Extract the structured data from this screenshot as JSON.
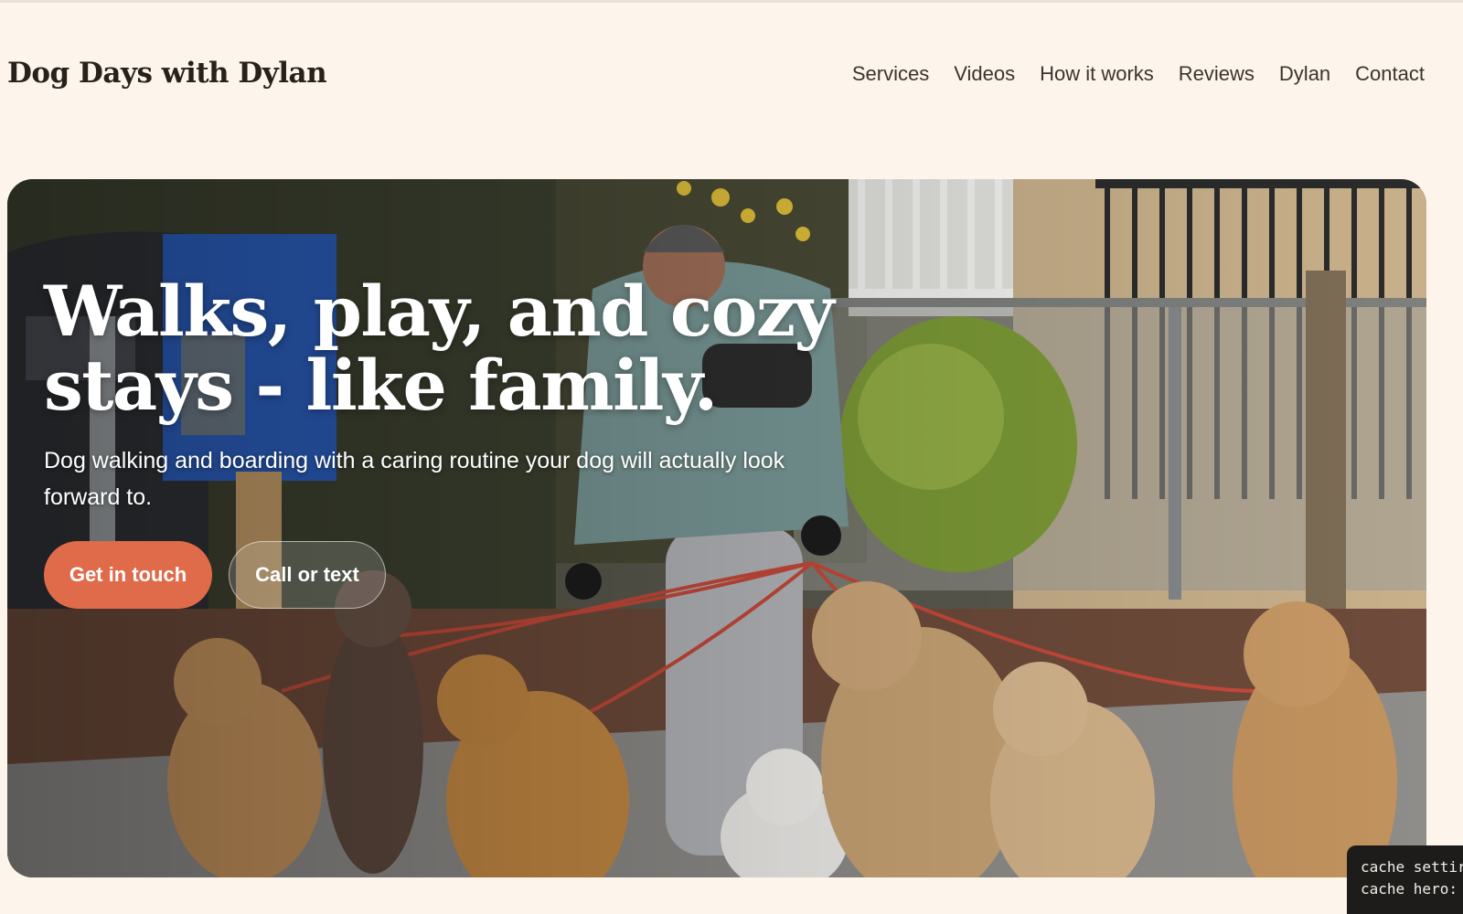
{
  "site": {
    "brand": "Dog Days with Dylan"
  },
  "nav": {
    "items": [
      {
        "label": "Services"
      },
      {
        "label": "Videos"
      },
      {
        "label": "How it works"
      },
      {
        "label": "Reviews"
      },
      {
        "label": "Dylan"
      },
      {
        "label": "Contact"
      }
    ]
  },
  "hero": {
    "title_line1": "Walks, play, and cozy",
    "title_line2": "stays - like family.",
    "subtitle": "Dog walking and boarding with a caring routine your dog will actually look forward to.",
    "primary_button": "Get in touch",
    "secondary_button": "Call or text",
    "accent_color": "#e06b4b"
  },
  "debug_overlay": {
    "line1": "cache settir",
    "line2": "cache hero: "
  }
}
